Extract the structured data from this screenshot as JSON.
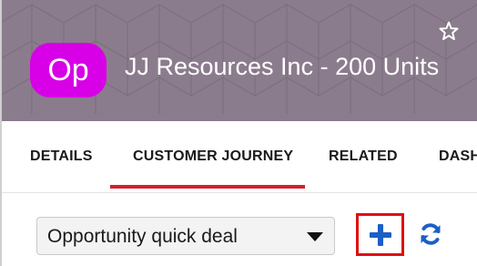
{
  "header": {
    "avatar_initials": "Op",
    "title": "JJ Resources Inc - 200 Units",
    "icons": {
      "favorite": "star-outline-icon"
    },
    "colors": {
      "banner": "#8a7a8a",
      "avatar": "#d800e6"
    }
  },
  "tabs": [
    {
      "label": "DETAILS",
      "active": false
    },
    {
      "label": "CUSTOMER JOURNEY",
      "active": true
    },
    {
      "label": "RELATED",
      "active": false
    },
    {
      "label": "DASH",
      "active": false
    }
  ],
  "toolbar": {
    "journey_select": {
      "value": "Opportunity quick deal",
      "icon": "caret-down-icon"
    },
    "add_icon": "plus-icon",
    "refresh_icon": "refresh-icon",
    "colors": {
      "accent": "#1b5fc7",
      "highlight_border": "#e01010",
      "active_tab_underline": "#d61f2c"
    }
  }
}
